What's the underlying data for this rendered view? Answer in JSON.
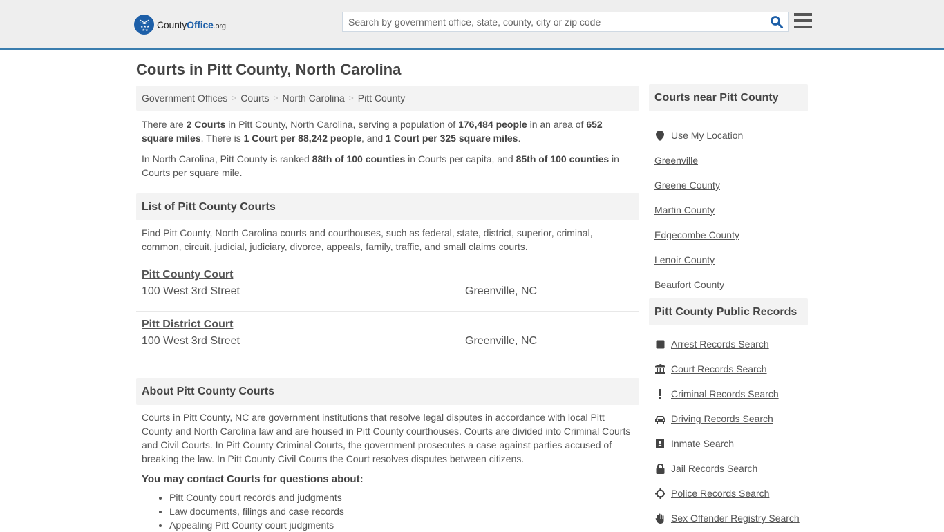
{
  "header": {
    "logo": {
      "county": "County",
      "office": "Office",
      "org": ".org"
    },
    "search_placeholder": "Search by government office, state, county, city or zip code",
    "search_value": "",
    "accent": "#1d5fa8",
    "border_accent": "#3a7dae"
  },
  "page_title": "Courts in Pitt County, North Carolina",
  "breadcrumb": [
    {
      "label": "Government Offices"
    },
    {
      "label": "Courts"
    },
    {
      "label": "North Carolina"
    },
    {
      "label": "Pitt County"
    }
  ],
  "summary": {
    "p1": [
      {
        "t": "There are ",
        "b": false
      },
      {
        "t": "2 Courts",
        "b": true
      },
      {
        "t": " in Pitt County, North Carolina, serving a population of ",
        "b": false
      },
      {
        "t": "176,484 people",
        "b": true
      },
      {
        "t": " in an area of ",
        "b": false
      },
      {
        "t": "652 square miles",
        "b": true
      },
      {
        "t": ". There is ",
        "b": false
      },
      {
        "t": "1 Court per 88,242 people",
        "b": true
      },
      {
        "t": ", and ",
        "b": false
      },
      {
        "t": "1 Court per 325 square miles",
        "b": true
      },
      {
        "t": ".",
        "b": false
      }
    ],
    "p2": [
      {
        "t": "In North Carolina, Pitt County is ranked ",
        "b": false
      },
      {
        "t": "88th of 100 counties",
        "b": true
      },
      {
        "t": " in Courts per capita, and ",
        "b": false
      },
      {
        "t": "85th of 100 counties",
        "b": true
      },
      {
        "t": " in Courts per square mile.",
        "b": false
      }
    ]
  },
  "list_section": {
    "heading": "List of Pitt County Courts",
    "description": "Find Pitt County, North Carolina courts and courthouses, such as federal, state, district, superior, criminal, common, circuit, judicial, judiciary, divorce, appeals, family, traffic, and small claims courts.",
    "courts": [
      {
        "name": "Pitt County Court",
        "address": "100 West 3rd Street",
        "city": "Greenville, NC"
      },
      {
        "name": "Pitt District Court",
        "address": "100 West 3rd Street",
        "city": "Greenville, NC"
      }
    ]
  },
  "about_section": {
    "heading": "About Pitt County Courts",
    "body": "Courts in Pitt County, NC are government institutions that resolve legal disputes in accordance with local Pitt County and North Carolina law and are housed in Pitt County courthouses. Courts are divided into Criminal Courts and Civil Courts. In Pitt County Criminal Courts, the government prosecutes a case against parties accused of breaking the law. In Pitt County Civil Courts the Court resolves disputes between citizens.",
    "contact_heading": "You may contact Courts for questions about:",
    "contact_items": [
      "Pitt County court records and judgments",
      "Law documents, filings and case records",
      "Appealing Pitt County court judgments"
    ]
  },
  "sidebar": {
    "nearby": {
      "heading": "Courts near Pitt County",
      "use_location": {
        "label": "Use My Location",
        "icon": "map-marker-icon"
      },
      "links": [
        "Greenville",
        "Greene County",
        "Martin County",
        "Edgecombe County",
        "Lenoir County",
        "Beaufort County"
      ]
    },
    "records": {
      "heading": "Pitt County Public Records",
      "links": [
        {
          "label": "Arrest Records Search",
          "icon": "square-icon"
        },
        {
          "label": "Court Records Search",
          "icon": "courthouse-icon"
        },
        {
          "label": "Criminal Records Search",
          "icon": "exclamation-icon"
        },
        {
          "label": "Driving Records Search",
          "icon": "car-icon"
        },
        {
          "label": "Inmate Search",
          "icon": "id-badge-icon"
        },
        {
          "label": "Jail Records Search",
          "icon": "lock-icon"
        },
        {
          "label": "Police Records Search",
          "icon": "crosshairs-icon"
        },
        {
          "label": "Sex Offender Registry Search",
          "icon": "hand-icon"
        }
      ]
    }
  }
}
